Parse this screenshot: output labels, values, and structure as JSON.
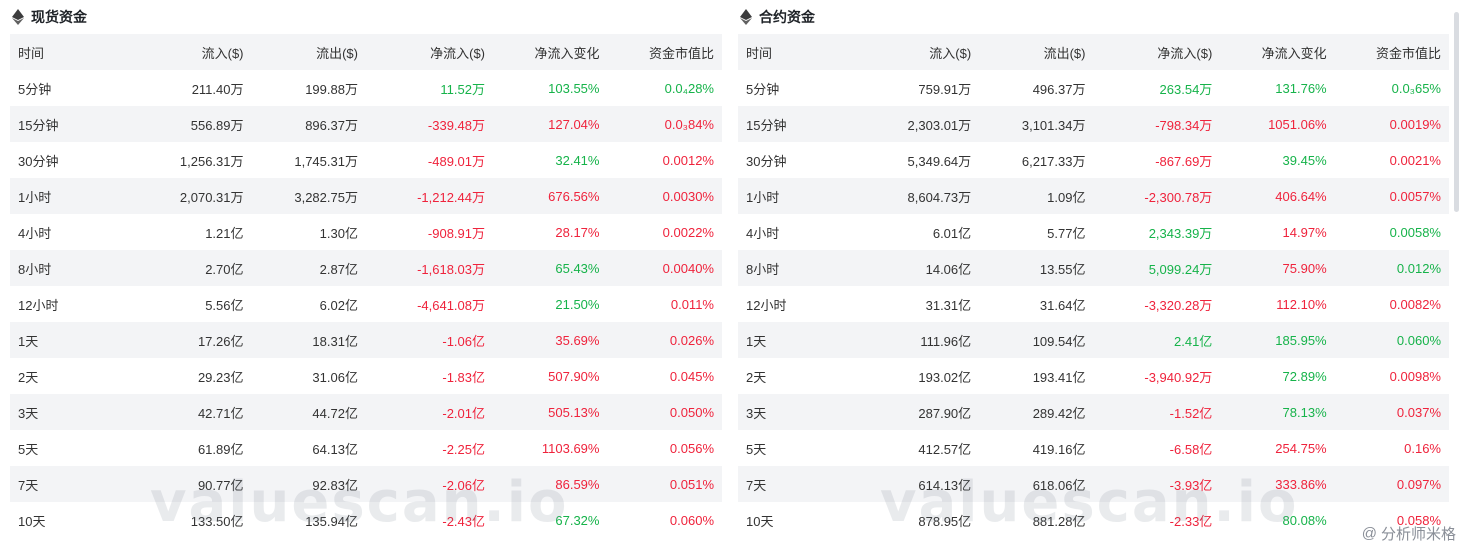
{
  "spot": {
    "title": "现货资金",
    "headers": [
      "时间",
      "流入($)",
      "流出($)",
      "净流入($)",
      "净流入变化",
      "资金市值比"
    ],
    "rows": [
      {
        "time": "5分钟",
        "in": "211.40万",
        "out": "199.88万",
        "net": "11.52万",
        "net_s": "pos",
        "chg": "103.55%",
        "chg_s": "pos",
        "ratio": "0.0₄28%",
        "ratio_s": "pos"
      },
      {
        "time": "15分钟",
        "in": "556.89万",
        "out": "896.37万",
        "net": "-339.48万",
        "net_s": "neg",
        "chg": "127.04%",
        "chg_s": "neg",
        "ratio": "0.0₃84%",
        "ratio_s": "neg"
      },
      {
        "time": "30分钟",
        "in": "1,256.31万",
        "out": "1,745.31万",
        "net": "-489.01万",
        "net_s": "neg",
        "chg": "32.41%",
        "chg_s": "pos",
        "ratio": "0.0012%",
        "ratio_s": "neg"
      },
      {
        "time": "1小时",
        "in": "2,070.31万",
        "out": "3,282.75万",
        "net": "-1,212.44万",
        "net_s": "neg",
        "chg": "676.56%",
        "chg_s": "neg",
        "ratio": "0.0030%",
        "ratio_s": "neg"
      },
      {
        "time": "4小时",
        "in": "1.21亿",
        "out": "1.30亿",
        "net": "-908.91万",
        "net_s": "neg",
        "chg": "28.17%",
        "chg_s": "neg",
        "ratio": "0.0022%",
        "ratio_s": "neg"
      },
      {
        "time": "8小时",
        "in": "2.70亿",
        "out": "2.87亿",
        "net": "-1,618.03万",
        "net_s": "neg",
        "chg": "65.43%",
        "chg_s": "pos",
        "ratio": "0.0040%",
        "ratio_s": "neg"
      },
      {
        "time": "12小时",
        "in": "5.56亿",
        "out": "6.02亿",
        "net": "-4,641.08万",
        "net_s": "neg",
        "chg": "21.50%",
        "chg_s": "pos",
        "ratio": "0.011%",
        "ratio_s": "neg"
      },
      {
        "time": "1天",
        "in": "17.26亿",
        "out": "18.31亿",
        "net": "-1.06亿",
        "net_s": "neg",
        "chg": "35.69%",
        "chg_s": "neg",
        "ratio": "0.026%",
        "ratio_s": "neg"
      },
      {
        "time": "2天",
        "in": "29.23亿",
        "out": "31.06亿",
        "net": "-1.83亿",
        "net_s": "neg",
        "chg": "507.90%",
        "chg_s": "neg",
        "ratio": "0.045%",
        "ratio_s": "neg"
      },
      {
        "time": "3天",
        "in": "42.71亿",
        "out": "44.72亿",
        "net": "-2.01亿",
        "net_s": "neg",
        "chg": "505.13%",
        "chg_s": "neg",
        "ratio": "0.050%",
        "ratio_s": "neg"
      },
      {
        "time": "5天",
        "in": "61.89亿",
        "out": "64.13亿",
        "net": "-2.25亿",
        "net_s": "neg",
        "chg": "1103.69%",
        "chg_s": "neg",
        "ratio": "0.056%",
        "ratio_s": "neg"
      },
      {
        "time": "7天",
        "in": "90.77亿",
        "out": "92.83亿",
        "net": "-2.06亿",
        "net_s": "neg",
        "chg": "86.59%",
        "chg_s": "neg",
        "ratio": "0.051%",
        "ratio_s": "neg"
      },
      {
        "time": "10天",
        "in": "133.50亿",
        "out": "135.94亿",
        "net": "-2.43亿",
        "net_s": "neg",
        "chg": "67.32%",
        "chg_s": "pos",
        "ratio": "0.060%",
        "ratio_s": "neg"
      }
    ]
  },
  "futures": {
    "title": "合约资金",
    "headers": [
      "时间",
      "流入($)",
      "流出($)",
      "净流入($)",
      "净流入变化",
      "资金市值比"
    ],
    "rows": [
      {
        "time": "5分钟",
        "in": "759.91万",
        "out": "496.37万",
        "net": "263.54万",
        "net_s": "pos",
        "chg": "131.76%",
        "chg_s": "pos",
        "ratio": "0.0₃65%",
        "ratio_s": "pos"
      },
      {
        "time": "15分钟",
        "in": "2,303.01万",
        "out": "3,101.34万",
        "net": "-798.34万",
        "net_s": "neg",
        "chg": "1051.06%",
        "chg_s": "neg",
        "ratio": "0.0019%",
        "ratio_s": "neg"
      },
      {
        "time": "30分钟",
        "in": "5,349.64万",
        "out": "6,217.33万",
        "net": "-867.69万",
        "net_s": "neg",
        "chg": "39.45%",
        "chg_s": "pos",
        "ratio": "0.0021%",
        "ratio_s": "neg"
      },
      {
        "time": "1小时",
        "in": "8,604.73万",
        "out": "1.09亿",
        "net": "-2,300.78万",
        "net_s": "neg",
        "chg": "406.64%",
        "chg_s": "neg",
        "ratio": "0.0057%",
        "ratio_s": "neg"
      },
      {
        "time": "4小时",
        "in": "6.01亿",
        "out": "5.77亿",
        "net": "2,343.39万",
        "net_s": "pos",
        "chg": "14.97%",
        "chg_s": "neg",
        "ratio": "0.0058%",
        "ratio_s": "pos"
      },
      {
        "time": "8小时",
        "in": "14.06亿",
        "out": "13.55亿",
        "net": "5,099.24万",
        "net_s": "pos",
        "chg": "75.90%",
        "chg_s": "neg",
        "ratio": "0.012%",
        "ratio_s": "pos"
      },
      {
        "time": "12小时",
        "in": "31.31亿",
        "out": "31.64亿",
        "net": "-3,320.28万",
        "net_s": "neg",
        "chg": "112.10%",
        "chg_s": "neg",
        "ratio": "0.0082%",
        "ratio_s": "neg"
      },
      {
        "time": "1天",
        "in": "111.96亿",
        "out": "109.54亿",
        "net": "2.41亿",
        "net_s": "pos",
        "chg": "185.95%",
        "chg_s": "pos",
        "ratio": "0.060%",
        "ratio_s": "pos"
      },
      {
        "time": "2天",
        "in": "193.02亿",
        "out": "193.41亿",
        "net": "-3,940.92万",
        "net_s": "neg",
        "chg": "72.89%",
        "chg_s": "pos",
        "ratio": "0.0098%",
        "ratio_s": "neg"
      },
      {
        "time": "3天",
        "in": "287.90亿",
        "out": "289.42亿",
        "net": "-1.52亿",
        "net_s": "neg",
        "chg": "78.13%",
        "chg_s": "pos",
        "ratio": "0.037%",
        "ratio_s": "neg"
      },
      {
        "time": "5天",
        "in": "412.57亿",
        "out": "419.16亿",
        "net": "-6.58亿",
        "net_s": "neg",
        "chg": "254.75%",
        "chg_s": "neg",
        "ratio": "0.16%",
        "ratio_s": "neg"
      },
      {
        "time": "7天",
        "in": "614.13亿",
        "out": "618.06亿",
        "net": "-3.93亿",
        "net_s": "neg",
        "chg": "333.86%",
        "chg_s": "neg",
        "ratio": "0.097%",
        "ratio_s": "neg"
      },
      {
        "time": "10天",
        "in": "878.95亿",
        "out": "881.28亿",
        "net": "-2.33亿",
        "net_s": "neg",
        "chg": "80.08%",
        "chg_s": "pos",
        "ratio": "0.058%",
        "ratio_s": "neg"
      }
    ]
  },
  "watermark": "valuescan.io",
  "corner_tag": "分析师米格",
  "colors": {
    "positive": "#16b34a",
    "negative": "#ef233c",
    "row_alt": "#f3f4f6"
  },
  "icons": {
    "panel": "ethereum-icon",
    "corner": "at-sign-icon"
  }
}
